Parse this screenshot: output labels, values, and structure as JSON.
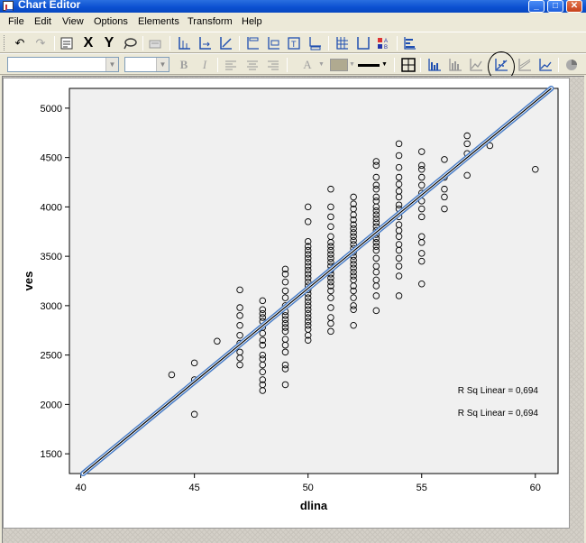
{
  "window": {
    "title": "Chart Editor"
  },
  "menu": [
    "File",
    "Edit",
    "View",
    "Options",
    "Elements",
    "Transform",
    "Help"
  ],
  "toolbar": {
    "undo_icon": "undo-icon",
    "redo_icon": "redo-icon",
    "x_label": "X",
    "y_label": "Y",
    "bold_label": "B",
    "italic_label": "I",
    "font_color_label": "A",
    "highlighted_button": "add-fit-line-total-icon"
  },
  "font_combo": {
    "value": ""
  },
  "size_combo": {
    "value": ""
  },
  "colors": {
    "plot_bg": "#f0f0f0",
    "fit_line_outer": "#4a7ec8",
    "fit_line_inner": "#000000",
    "titlebar": "#0a4fd0"
  },
  "chart_data": {
    "type": "scatter",
    "xlabel": "dlina",
    "ylabel": "ves",
    "xlim": [
      39.5,
      61
    ],
    "ylim": [
      1300,
      5200
    ],
    "xticks": [
      40,
      45,
      50,
      55,
      60
    ],
    "yticks": [
      1500,
      2000,
      2500,
      3000,
      3500,
      4000,
      4500,
      5000
    ],
    "grid": false,
    "annotations": [
      "R Sq Linear = 0,694",
      "R Sq Linear = 0,694"
    ],
    "fit_line": {
      "x": [
        40.1,
        60.7
      ],
      "y": [
        1300,
        5200
      ]
    },
    "points": [
      [
        44,
        2300
      ],
      [
        45,
        2420
      ],
      [
        45,
        2250
      ],
      [
        45,
        1900
      ],
      [
        46,
        2640
      ],
      [
        47,
        3160
      ],
      [
        47,
        2980
      ],
      [
        47,
        2900
      ],
      [
        47,
        2800
      ],
      [
        47,
        2700
      ],
      [
        47,
        2620
      ],
      [
        47,
        2530
      ],
      [
        47,
        2470
      ],
      [
        47,
        2400
      ],
      [
        48,
        3050
      ],
      [
        48,
        2960
      ],
      [
        48,
        2920
      ],
      [
        48,
        2880
      ],
      [
        48,
        2840
      ],
      [
        48,
        2780
      ],
      [
        48,
        2720
      ],
      [
        48,
        2650
      ],
      [
        48,
        2600
      ],
      [
        48,
        2500
      ],
      [
        48,
        2460
      ],
      [
        48,
        2400
      ],
      [
        48,
        2330
      ],
      [
        48,
        2250
      ],
      [
        48,
        2200
      ],
      [
        48,
        2140
      ],
      [
        49,
        3370
      ],
      [
        49,
        3320
      ],
      [
        49,
        3240
      ],
      [
        49,
        3150
      ],
      [
        49,
        3080
      ],
      [
        49,
        3000
      ],
      [
        49,
        2940
      ],
      [
        49,
        2900
      ],
      [
        49,
        2860
      ],
      [
        49,
        2820
      ],
      [
        49,
        2780
      ],
      [
        49,
        2740
      ],
      [
        49,
        2660
      ],
      [
        49,
        2600
      ],
      [
        49,
        2530
      ],
      [
        49,
        2400
      ],
      [
        49,
        2360
      ],
      [
        49,
        2200
      ],
      [
        50,
        4000
      ],
      [
        50,
        3850
      ],
      [
        50,
        3650
      ],
      [
        50,
        3600
      ],
      [
        50,
        3560
      ],
      [
        50,
        3520
      ],
      [
        50,
        3480
      ],
      [
        50,
        3440
      ],
      [
        50,
        3400
      ],
      [
        50,
        3360
      ],
      [
        50,
        3320
      ],
      [
        50,
        3280
      ],
      [
        50,
        3240
      ],
      [
        50,
        3200
      ],
      [
        50,
        3160
      ],
      [
        50,
        3120
      ],
      [
        50,
        3080
      ],
      [
        50,
        3040
      ],
      [
        50,
        3000
      ],
      [
        50,
        2960
      ],
      [
        50,
        2920
      ],
      [
        50,
        2880
      ],
      [
        50,
        2840
      ],
      [
        50,
        2800
      ],
      [
        50,
        2760
      ],
      [
        50,
        2700
      ],
      [
        50,
        2650
      ],
      [
        51,
        4180
      ],
      [
        51,
        4000
      ],
      [
        51,
        3900
      ],
      [
        51,
        3800
      ],
      [
        51,
        3700
      ],
      [
        51,
        3640
      ],
      [
        51,
        3600
      ],
      [
        51,
        3560
      ],
      [
        51,
        3520
      ],
      [
        51,
        3480
      ],
      [
        51,
        3440
      ],
      [
        51,
        3400
      ],
      [
        51,
        3360
      ],
      [
        51,
        3320
      ],
      [
        51,
        3280
      ],
      [
        51,
        3240
      ],
      [
        51,
        3200
      ],
      [
        51,
        3150
      ],
      [
        51,
        3080
      ],
      [
        51,
        2980
      ],
      [
        51,
        2880
      ],
      [
        51,
        2820
      ],
      [
        51,
        2740
      ],
      [
        52,
        4100
      ],
      [
        52,
        4030
      ],
      [
        52,
        3980
      ],
      [
        52,
        3920
      ],
      [
        52,
        3870
      ],
      [
        52,
        3820
      ],
      [
        52,
        3780
      ],
      [
        52,
        3740
      ],
      [
        52,
        3700
      ],
      [
        52,
        3660
      ],
      [
        52,
        3620
      ],
      [
        52,
        3580
      ],
      [
        52,
        3540
      ],
      [
        52,
        3500
      ],
      [
        52,
        3460
      ],
      [
        52,
        3420
      ],
      [
        52,
        3380
      ],
      [
        52,
        3340
      ],
      [
        52,
        3300
      ],
      [
        52,
        3260
      ],
      [
        52,
        3200
      ],
      [
        52,
        3150
      ],
      [
        52,
        3080
      ],
      [
        52,
        3000
      ],
      [
        52,
        2960
      ],
      [
        52,
        2800
      ],
      [
        53,
        4460
      ],
      [
        53,
        4420
      ],
      [
        53,
        4300
      ],
      [
        53,
        4220
      ],
      [
        53,
        4180
      ],
      [
        53,
        4100
      ],
      [
        53,
        4060
      ],
      [
        53,
        4000
      ],
      [
        53,
        3960
      ],
      [
        53,
        3920
      ],
      [
        53,
        3880
      ],
      [
        53,
        3840
      ],
      [
        53,
        3800
      ],
      [
        53,
        3760
      ],
      [
        53,
        3720
      ],
      [
        53,
        3680
      ],
      [
        53,
        3640
      ],
      [
        53,
        3600
      ],
      [
        53,
        3560
      ],
      [
        53,
        3480
      ],
      [
        53,
        3400
      ],
      [
        53,
        3340
      ],
      [
        53,
        3260
      ],
      [
        53,
        3200
      ],
      [
        53,
        3100
      ],
      [
        53,
        2950
      ],
      [
        54,
        4640
      ],
      [
        54,
        4520
      ],
      [
        54,
        4400
      ],
      [
        54,
        4300
      ],
      [
        54,
        4230
      ],
      [
        54,
        4160
      ],
      [
        54,
        4100
      ],
      [
        54,
        4020
      ],
      [
        54,
        3980
      ],
      [
        54,
        3900
      ],
      [
        54,
        3820
      ],
      [
        54,
        3760
      ],
      [
        54,
        3700
      ],
      [
        54,
        3620
      ],
      [
        54,
        3560
      ],
      [
        54,
        3480
      ],
      [
        54,
        3400
      ],
      [
        54,
        3300
      ],
      [
        54,
        3100
      ],
      [
        55,
        4560
      ],
      [
        55,
        4420
      ],
      [
        55,
        4380
      ],
      [
        55,
        4300
      ],
      [
        55,
        4220
      ],
      [
        55,
        4140
      ],
      [
        55,
        4060
      ],
      [
        55,
        3980
      ],
      [
        55,
        3900
      ],
      [
        55,
        3700
      ],
      [
        55,
        3640
      ],
      [
        55,
        3530
      ],
      [
        55,
        3450
      ],
      [
        55,
        3220
      ],
      [
        56,
        4480
      ],
      [
        56,
        4300
      ],
      [
        56,
        4180
      ],
      [
        56,
        4100
      ],
      [
        56,
        3980
      ],
      [
        57,
        4720
      ],
      [
        57,
        4640
      ],
      [
        57,
        4540
      ],
      [
        57,
        4320
      ],
      [
        58,
        4620
      ],
      [
        60,
        4380
      ]
    ]
  }
}
